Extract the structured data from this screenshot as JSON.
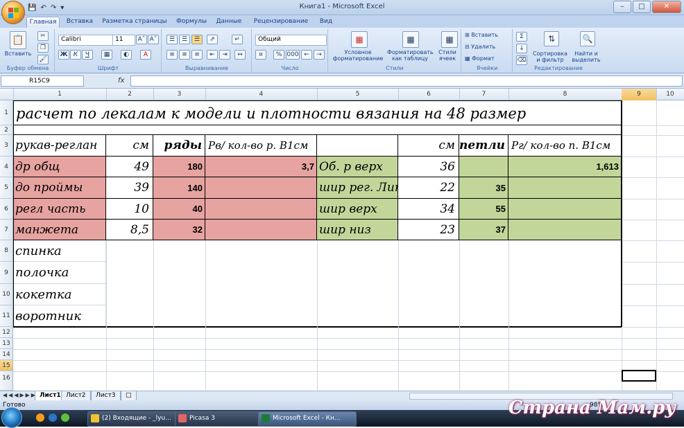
{
  "window": {
    "title": "Книга1 - Microsoft Excel"
  },
  "tabs": [
    "Главная",
    "Вставка",
    "Разметка страницы",
    "Формулы",
    "Данные",
    "Рецензирование",
    "Вид"
  ],
  "ribbon": {
    "clipboard": {
      "label": "Буфер обмена",
      "paste": "Вставить"
    },
    "font": {
      "label": "Шрифт",
      "name": "Calibri",
      "size": "11",
      "bold": "Ж",
      "italic": "К",
      "underline": "Ч"
    },
    "alignment": {
      "label": "Выравнивание"
    },
    "number": {
      "label": "Число",
      "format": "Общий",
      "percent": "%",
      "thousands": "000"
    },
    "styles": {
      "label": "Стили",
      "conditional": "Условное форматирование",
      "as_table": "Форматировать как таблицу",
      "cell_styles": "Стили ячеек"
    },
    "cells": {
      "label": "Ячейки",
      "insert": "Вставить",
      "delete": "Удалить",
      "format": "Формат"
    },
    "editing": {
      "label": "Редактирование",
      "sort": "Сортировка и фильтр",
      "find": "Найти и выделить"
    }
  },
  "formula_bar": {
    "name_box": "R15C9",
    "fx": "fx",
    "value": ""
  },
  "columns": [
    "1",
    "2",
    "3",
    "4",
    "5",
    "6",
    "7",
    "8",
    "9",
    "10"
  ],
  "rows": [
    "1",
    "2",
    "3",
    "4",
    "5",
    "6",
    "7",
    "8",
    "9",
    "10",
    "11",
    "12",
    "13",
    "14",
    "15",
    "16"
  ],
  "sheet": {
    "title": "расчет по лекалам к модели и плотности вязания на 48 размер",
    "h_sleeve": "рукав-реглан",
    "h_cm": "см",
    "h_rows": "ряды",
    "h_rv": "Рв/ кол-во р. В1см",
    "h_cm2": "см",
    "h_loops": "петли",
    "h_rg": "Рг/ кол-во п. В1см",
    "r4": {
      "a": "др общ",
      "b": "49",
      "c": "180",
      "d": "3,7",
      "e": "Об. р верх",
      "f": "36",
      "g": "",
      "h": "1,613"
    },
    "r5": {
      "a": "до проймы",
      "b": "39",
      "c": "140",
      "e": "шир рег. Лин",
      "f": "22",
      "g": "35"
    },
    "r6": {
      "a": "регл часть",
      "b": "10",
      "c": "40",
      "e": "шир верх",
      "f": "34",
      "g": "55"
    },
    "r7": {
      "a": "манжета",
      "b": "8,5",
      "c": "32",
      "e": "шир низ",
      "f": "23",
      "g": "37"
    },
    "r8": "спинка",
    "r9": "полочка",
    "r10": "кокетка",
    "r11": "воротник"
  },
  "sheet_tabs": [
    "Лист1",
    "Лист2",
    "Лист3"
  ],
  "status": {
    "ready": "Готово",
    "zoom": "98%"
  },
  "taskbar": [
    {
      "label": "(2) Входящие - _lyu..."
    },
    {
      "label": "Picasa 3"
    },
    {
      "label": "Microsoft Excel - Кн..."
    }
  ],
  "watermark": "Страна Мам.ру",
  "colors": {
    "pink": "#e6a3a0",
    "green": "#c2d69a",
    "selected_header": "#f1c15f"
  }
}
